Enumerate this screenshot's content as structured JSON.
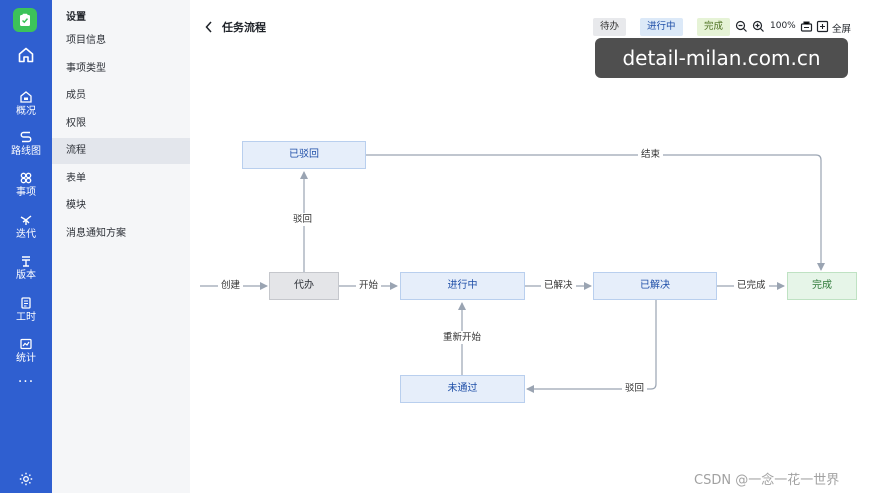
{
  "rail": {
    "items": [
      {
        "label": "概况",
        "icon": "overview-icon"
      },
      {
        "label": "路线图",
        "icon": "roadmap-icon"
      },
      {
        "label": "事项",
        "icon": "items-icon"
      },
      {
        "label": "迭代",
        "icon": "iteration-icon"
      },
      {
        "label": "版本",
        "icon": "version-icon"
      },
      {
        "label": "工时",
        "icon": "worktime-icon"
      },
      {
        "label": "统计",
        "icon": "statistics-icon"
      }
    ],
    "more": "···"
  },
  "settings_menu": {
    "title": "设置",
    "items": [
      {
        "label": "项目信息"
      },
      {
        "label": "事项类型"
      },
      {
        "label": "成员"
      },
      {
        "label": "权限"
      },
      {
        "label": "流程",
        "active": true
      },
      {
        "label": "表单"
      },
      {
        "label": "模块"
      },
      {
        "label": "消息通知方案"
      }
    ]
  },
  "header": {
    "title": "任务流程",
    "legend": {
      "todo": "待办",
      "doing": "进行中",
      "done": "完成"
    },
    "zoom": "100%",
    "fullscreen": "全屏"
  },
  "watermark": "detail-milan.com.cn",
  "credit": "CSDN @一念一花一世界",
  "flow": {
    "nodes": {
      "rejected": "已驳回",
      "pending": "代办",
      "in_progress": "进行中",
      "resolved": "已解决",
      "complete": "完成",
      "not_passed": "未通过"
    },
    "edges": {
      "create": "创建",
      "start": "开始",
      "reject_up": "驳回",
      "end": "结束",
      "resolved": "已解决",
      "completed": "已完成",
      "restart": "重新开始",
      "reject_back": "驳回"
    }
  },
  "colors": {
    "rail": "#2f5fd0",
    "node_in_progress": "#e6eefa",
    "node_pending": "#e4e5e8",
    "node_final": "#e6f5e8",
    "edge": "#9aa4b2"
  }
}
